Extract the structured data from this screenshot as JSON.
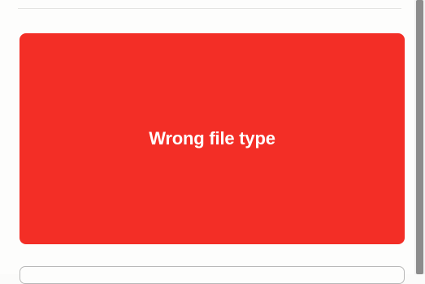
{
  "upload": {
    "error_message": "Wrong file type"
  },
  "colors": {
    "error_background": "#f32e26",
    "error_text": "#ffffff",
    "scrollbar_thumb": "#8c8c8c"
  }
}
